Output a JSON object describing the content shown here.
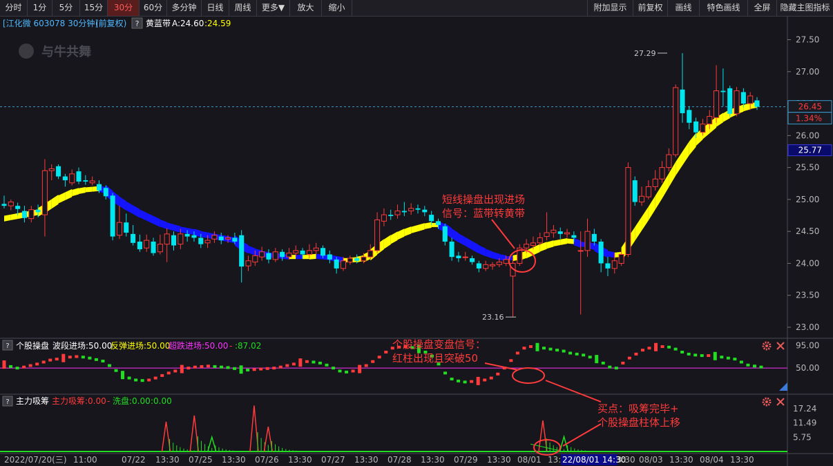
{
  "toolbar": {
    "left": [
      "分时",
      "1分",
      "5分",
      "15分",
      "30分",
      "60分",
      "多分钟",
      "日线",
      "周线",
      "更多▼",
      "放大",
      "缩小"
    ],
    "active": "30分",
    "right": [
      "附加显示",
      "前复权",
      "画线",
      "特色画线",
      "全屏",
      "隐藏主图指标"
    ]
  },
  "main_header": {
    "stock": "[江化微 603078 30分钟]",
    "adjust": "(前复权)",
    "help": "?",
    "indicator": "黄蓝带",
    "a_label": "A:24.60",
    "b_label": ":24.59"
  },
  "watermark": "与牛共舞",
  "price_axis": {
    "ticks": [
      "27.50",
      "27.00",
      "26.50",
      "26.00",
      "25.50",
      "25.00",
      "24.50",
      "24.00",
      "23.50",
      "23.00"
    ],
    "current_price": "26.45",
    "current_change": "1.34%",
    "yellow_band_value": "25.77"
  },
  "markers": {
    "high": "27.29",
    "low": "23.16"
  },
  "annotations": {
    "main_note_1": "短线操盘出现进场",
    "main_note_2": "信号：蓝带转黄带",
    "sub1_note_1": "个股操盘变盘信号：",
    "sub1_note_2": "红柱出现且突破50",
    "sub2_note_1": "买点：吸筹完毕+",
    "sub2_note_2": "个股操盘柱体上移"
  },
  "sub1": {
    "help": "?",
    "name": "个股操盘",
    "wave": "波段进场:50.00",
    "rebound": "反弹进场:50.00",
    "oversold": "超跌进场:50.00",
    "sep": "-",
    "value": ":87.02",
    "ticks": [
      "95.00",
      "50.00"
    ]
  },
  "sub2": {
    "help": "?",
    "name": "主力吸筹",
    "absorb": "主力吸筹:0.00",
    "dash": "-",
    "wash": "洗盘:0.00",
    "value": ":0.00",
    "ticks": [
      "17.24",
      "11.49",
      "5.75"
    ]
  },
  "time_axis": {
    "labels": [
      "2022/07/20(三)",
      "11:00",
      "07/22",
      "13:30",
      "07/25",
      "13:30",
      "07/26",
      "13:30",
      "07/27",
      "13:30",
      "07/28",
      "13:30",
      "07/29",
      "13:30",
      "08/01",
      "13:",
      "13:30",
      "08/03",
      "13:30",
      "08/04",
      "13:30"
    ],
    "cursor": "22/08/01 14:30"
  },
  "colors": {
    "up": "#ff3b3b",
    "down": "#00e5ee",
    "yellow_band": "#ffff00",
    "blue_band": "#1414ff",
    "accent": "#ff3b3b",
    "midline": "#ff33ff",
    "green": "#22dd22"
  },
  "chart_data": {
    "type": "candlestick",
    "ylim": [
      23.0,
      27.5
    ],
    "notes": "Approximate 30-minute candles read from the screenshot; band_color y = yellow band, b = blue band",
    "candles": [
      {
        "o": 24.93,
        "c": 24.9,
        "h": 25.06,
        "l": 24.86,
        "band": 24.7,
        "bc": "y"
      },
      {
        "o": 24.9,
        "c": 24.96,
        "h": 25.0,
        "l": 24.83,
        "band": 24.72,
        "bc": "y"
      },
      {
        "o": 24.9,
        "c": 24.85,
        "h": 24.95,
        "l": 24.75,
        "band": 24.74,
        "bc": "y"
      },
      {
        "o": 24.82,
        "c": 24.71,
        "h": 24.9,
        "l": 24.64,
        "band": 24.76,
        "bc": "y"
      },
      {
        "o": 24.7,
        "c": 24.84,
        "h": 24.9,
        "l": 24.64,
        "band": 24.78,
        "bc": "y"
      },
      {
        "o": 24.84,
        "c": 24.8,
        "h": 24.92,
        "l": 24.72,
        "band": 24.8,
        "bc": "y"
      },
      {
        "o": 24.76,
        "c": 25.45,
        "h": 25.63,
        "l": 24.42,
        "band": 24.86,
        "bc": "y"
      },
      {
        "o": 25.45,
        "c": 25.48,
        "h": 25.55,
        "l": 25.3,
        "band": 24.93,
        "bc": "y"
      },
      {
        "o": 25.52,
        "c": 25.36,
        "h": 25.55,
        "l": 25.32,
        "band": 25.0,
        "bc": "y"
      },
      {
        "o": 25.36,
        "c": 25.3,
        "h": 25.4,
        "l": 25.2,
        "band": 25.05,
        "bc": "y"
      },
      {
        "o": 25.26,
        "c": 25.4,
        "h": 25.47,
        "l": 25.22,
        "band": 25.1,
        "bc": "y"
      },
      {
        "o": 25.44,
        "c": 25.28,
        "h": 25.5,
        "l": 25.24,
        "band": 25.13,
        "bc": "y"
      },
      {
        "o": 25.3,
        "c": 25.28,
        "h": 25.38,
        "l": 25.23,
        "band": 25.15,
        "bc": "y"
      },
      {
        "o": 25.26,
        "c": 25.29,
        "h": 25.36,
        "l": 25.22,
        "band": 25.16,
        "bc": "y"
      },
      {
        "o": 25.24,
        "c": 25.14,
        "h": 25.3,
        "l": 25.1,
        "band": 25.17,
        "bc": "y"
      },
      {
        "o": 25.18,
        "c": 25.05,
        "h": 25.22,
        "l": 25.0,
        "band": 25.14,
        "bc": "b"
      },
      {
        "o": 25.06,
        "c": 24.42,
        "h": 25.1,
        "l": 24.36,
        "band": 25.05,
        "bc": "b"
      },
      {
        "o": 24.44,
        "c": 24.64,
        "h": 24.9,
        "l": 24.38,
        "band": 24.97,
        "bc": "b"
      },
      {
        "o": 24.64,
        "c": 24.48,
        "h": 24.78,
        "l": 24.42,
        "band": 24.9,
        "bc": "b"
      },
      {
        "o": 24.46,
        "c": 24.32,
        "h": 24.6,
        "l": 24.28,
        "band": 24.84,
        "bc": "b"
      },
      {
        "o": 24.34,
        "c": 24.22,
        "h": 24.45,
        "l": 24.18,
        "band": 24.78,
        "bc": "b"
      },
      {
        "o": 24.24,
        "c": 24.36,
        "h": 24.45,
        "l": 24.18,
        "band": 24.73,
        "bc": "b"
      },
      {
        "o": 24.34,
        "c": 24.16,
        "h": 24.4,
        "l": 24.12,
        "band": 24.68,
        "bc": "b"
      },
      {
        "o": 24.18,
        "c": 24.3,
        "h": 24.45,
        "l": 24.14,
        "band": 24.63,
        "bc": "b"
      },
      {
        "o": 24.3,
        "c": 24.46,
        "h": 24.55,
        "l": 24.02,
        "band": 24.59,
        "bc": "b"
      },
      {
        "o": 24.44,
        "c": 24.28,
        "h": 24.5,
        "l": 24.2,
        "band": 24.56,
        "bc": "b"
      },
      {
        "o": 24.3,
        "c": 24.46,
        "h": 24.54,
        "l": 24.22,
        "band": 24.53,
        "bc": "b"
      },
      {
        "o": 24.46,
        "c": 24.42,
        "h": 24.52,
        "l": 24.34,
        "band": 24.51,
        "bc": "b"
      },
      {
        "o": 24.44,
        "c": 24.4,
        "h": 24.5,
        "l": 24.34,
        "band": 24.49,
        "bc": "b"
      },
      {
        "o": 24.4,
        "c": 24.3,
        "h": 24.46,
        "l": 24.24,
        "band": 24.46,
        "bc": "b"
      },
      {
        "o": 24.32,
        "c": 24.36,
        "h": 24.44,
        "l": 24.24,
        "band": 24.44,
        "bc": "b"
      },
      {
        "o": 24.38,
        "c": 24.44,
        "h": 24.5,
        "l": 24.32,
        "band": 24.42,
        "bc": "b"
      },
      {
        "o": 24.42,
        "c": 24.36,
        "h": 24.48,
        "l": 24.3,
        "band": 24.4,
        "bc": "b"
      },
      {
        "o": 24.38,
        "c": 24.4,
        "h": 24.44,
        "l": 24.32,
        "band": 24.38,
        "bc": "b"
      },
      {
        "o": 24.4,
        "c": 24.34,
        "h": 24.48,
        "l": 24.3,
        "band": 24.36,
        "bc": "b"
      },
      {
        "o": 24.44,
        "c": 23.95,
        "h": 24.52,
        "l": 23.7,
        "band": 24.28,
        "bc": "b"
      },
      {
        "o": 23.96,
        "c": 24.04,
        "h": 24.12,
        "l": 23.88,
        "band": 24.22,
        "bc": "b"
      },
      {
        "o": 24.02,
        "c": 24.12,
        "h": 24.2,
        "l": 23.96,
        "band": 24.18,
        "bc": "b"
      },
      {
        "o": 24.1,
        "c": 24.18,
        "h": 24.26,
        "l": 24.04,
        "band": 24.15,
        "bc": "b"
      },
      {
        "o": 24.16,
        "c": 24.06,
        "h": 24.22,
        "l": 24.0,
        "band": 24.13,
        "bc": "b"
      },
      {
        "o": 24.06,
        "c": 24.18,
        "h": 24.24,
        "l": 24.02,
        "band": 24.12,
        "bc": "b"
      },
      {
        "o": 24.18,
        "c": 24.1,
        "h": 24.22,
        "l": 24.04,
        "band": 24.11,
        "bc": "b"
      },
      {
        "o": 24.1,
        "c": 24.16,
        "h": 24.24,
        "l": 24.06,
        "band": 24.1,
        "bc": "b"
      },
      {
        "o": 24.16,
        "c": 24.2,
        "h": 24.28,
        "l": 24.1,
        "band": 24.1,
        "bc": "y"
      },
      {
        "o": 24.2,
        "c": 24.14,
        "h": 24.24,
        "l": 24.08,
        "band": 24.1,
        "bc": "b"
      },
      {
        "o": 24.14,
        "c": 24.2,
        "h": 24.3,
        "l": 24.08,
        "band": 24.1,
        "bc": "y"
      },
      {
        "o": 24.2,
        "c": 24.24,
        "h": 24.32,
        "l": 24.14,
        "band": 24.11,
        "bc": "y"
      },
      {
        "o": 24.24,
        "c": 24.12,
        "h": 24.28,
        "l": 24.08,
        "band": 24.1,
        "bc": "b"
      },
      {
        "o": 24.14,
        "c": 24.06,
        "h": 24.2,
        "l": 24.0,
        "band": 24.09,
        "bc": "b"
      },
      {
        "o": 24.06,
        "c": 23.92,
        "h": 24.1,
        "l": 23.84,
        "band": 24.07,
        "bc": "b"
      },
      {
        "o": 23.92,
        "c": 24.04,
        "h": 24.1,
        "l": 23.88,
        "band": 24.05,
        "bc": "b"
      },
      {
        "o": 24.02,
        "c": 24.08,
        "h": 24.12,
        "l": 23.98,
        "band": 24.05,
        "bc": "y"
      },
      {
        "o": 24.08,
        "c": 24.04,
        "h": 24.14,
        "l": 24.0,
        "band": 24.06,
        "bc": "y"
      },
      {
        "o": 24.04,
        "c": 24.1,
        "h": 24.16,
        "l": 24.0,
        "band": 24.08,
        "bc": "y"
      },
      {
        "o": 24.1,
        "c": 24.2,
        "h": 24.3,
        "l": 24.06,
        "band": 24.13,
        "bc": "y"
      },
      {
        "o": 24.2,
        "c": 24.68,
        "h": 24.8,
        "l": 24.16,
        "band": 24.22,
        "bc": "y"
      },
      {
        "o": 24.66,
        "c": 24.76,
        "h": 24.86,
        "l": 24.58,
        "band": 24.3,
        "bc": "y"
      },
      {
        "o": 24.76,
        "c": 24.74,
        "h": 24.84,
        "l": 24.68,
        "band": 24.37,
        "bc": "y"
      },
      {
        "o": 24.76,
        "c": 24.82,
        "h": 24.92,
        "l": 24.7,
        "band": 24.43,
        "bc": "y"
      },
      {
        "o": 24.82,
        "c": 24.8,
        "h": 24.96,
        "l": 24.74,
        "band": 24.48,
        "bc": "y"
      },
      {
        "o": 24.82,
        "c": 24.86,
        "h": 24.94,
        "l": 24.76,
        "band": 24.52,
        "bc": "y"
      },
      {
        "o": 24.86,
        "c": 24.84,
        "h": 24.92,
        "l": 24.78,
        "band": 24.55,
        "bc": "y"
      },
      {
        "o": 24.84,
        "c": 24.8,
        "h": 24.9,
        "l": 24.74,
        "band": 24.58,
        "bc": "y"
      },
      {
        "o": 24.76,
        "c": 24.66,
        "h": 24.82,
        "l": 24.6,
        "band": 24.6,
        "bc": "y"
      },
      {
        "o": 24.66,
        "c": 24.6,
        "h": 24.7,
        "l": 24.54,
        "band": 24.6,
        "bc": "y"
      },
      {
        "o": 24.58,
        "c": 24.34,
        "h": 24.62,
        "l": 24.28,
        "band": 24.55,
        "bc": "b"
      },
      {
        "o": 24.34,
        "c": 24.1,
        "h": 24.4,
        "l": 24.04,
        "band": 24.47,
        "bc": "b"
      },
      {
        "o": 24.12,
        "c": 24.08,
        "h": 24.18,
        "l": 24.02,
        "band": 24.4,
        "bc": "b"
      },
      {
        "o": 24.1,
        "c": 24.1,
        "h": 24.18,
        "l": 24.04,
        "band": 24.34,
        "bc": "b"
      },
      {
        "o": 24.08,
        "c": 24.02,
        "h": 24.12,
        "l": 23.98,
        "band": 24.28,
        "bc": "b"
      },
      {
        "o": 24.0,
        "c": 23.92,
        "h": 24.04,
        "l": 23.86,
        "band": 24.22,
        "bc": "b"
      },
      {
        "o": 23.92,
        "c": 23.98,
        "h": 24.04,
        "l": 23.88,
        "band": 24.17,
        "bc": "b"
      },
      {
        "o": 23.96,
        "c": 23.98,
        "h": 24.02,
        "l": 23.9,
        "band": 24.13,
        "bc": "b"
      },
      {
        "o": 23.98,
        "c": 24.02,
        "h": 24.08,
        "l": 23.94,
        "band": 24.1,
        "bc": "b"
      },
      {
        "o": 24.0,
        "c": 24.06,
        "h": 24.12,
        "l": 23.96,
        "band": 24.08,
        "bc": "b"
      },
      {
        "o": 23.8,
        "c": 24.0,
        "h": 24.1,
        "l": 23.16,
        "band": 24.08,
        "bc": "b"
      },
      {
        "o": 24.0,
        "c": 24.24,
        "h": 24.3,
        "l": 23.96,
        "band": 24.1,
        "bc": "y"
      },
      {
        "o": 24.24,
        "c": 24.3,
        "h": 24.38,
        "l": 24.16,
        "band": 24.14,
        "bc": "y"
      },
      {
        "o": 24.28,
        "c": 24.32,
        "h": 24.42,
        "l": 24.22,
        "band": 24.19,
        "bc": "y"
      },
      {
        "o": 24.32,
        "c": 24.4,
        "h": 24.48,
        "l": 24.28,
        "band": 24.24,
        "bc": "y"
      },
      {
        "o": 24.42,
        "c": 24.48,
        "h": 24.8,
        "l": 24.36,
        "band": 24.28,
        "bc": "y"
      },
      {
        "o": 24.48,
        "c": 24.52,
        "h": 24.6,
        "l": 24.4,
        "band": 24.31,
        "bc": "y"
      },
      {
        "o": 24.5,
        "c": 24.46,
        "h": 24.56,
        "l": 24.38,
        "band": 24.33,
        "bc": "y"
      },
      {
        "o": 24.46,
        "c": 24.48,
        "h": 24.54,
        "l": 24.4,
        "band": 24.35,
        "bc": "y"
      },
      {
        "o": 24.44,
        "c": 24.4,
        "h": 24.5,
        "l": 24.34,
        "band": 24.34,
        "bc": "y"
      },
      {
        "o": 24.2,
        "c": 24.2,
        "h": 24.5,
        "l": 23.2,
        "band": 24.3,
        "bc": "b"
      },
      {
        "o": 24.2,
        "c": 24.5,
        "h": 24.7,
        "l": 24.1,
        "band": 24.29,
        "bc": "b"
      },
      {
        "o": 24.46,
        "c": 24.34,
        "h": 24.54,
        "l": 24.28,
        "band": 24.26,
        "bc": "b"
      },
      {
        "o": 24.34,
        "c": 24.0,
        "h": 24.38,
        "l": 23.86,
        "band": 24.2,
        "bc": "b"
      },
      {
        "o": 24.0,
        "c": 23.92,
        "h": 24.1,
        "l": 23.8,
        "band": 24.15,
        "bc": "b"
      },
      {
        "o": 23.92,
        "c": 24.04,
        "h": 24.16,
        "l": 23.84,
        "band": 24.13,
        "bc": "b"
      },
      {
        "o": 24.0,
        "c": 24.14,
        "h": 24.2,
        "l": 23.96,
        "band": 24.14,
        "bc": "y"
      },
      {
        "o": 24.14,
        "c": 25.5,
        "h": 25.58,
        "l": 24.1,
        "band": 24.3,
        "bc": "y"
      },
      {
        "o": 25.3,
        "c": 24.96,
        "h": 25.36,
        "l": 24.9,
        "band": 24.46,
        "bc": "y"
      },
      {
        "o": 24.96,
        "c": 25.05,
        "h": 25.2,
        "l": 24.9,
        "band": 24.62,
        "bc": "y"
      },
      {
        "o": 25.04,
        "c": 25.2,
        "h": 25.3,
        "l": 25.0,
        "band": 24.78,
        "bc": "y"
      },
      {
        "o": 25.2,
        "c": 25.32,
        "h": 25.46,
        "l": 25.14,
        "band": 24.95,
        "bc": "y"
      },
      {
        "o": 25.32,
        "c": 25.5,
        "h": 25.6,
        "l": 25.26,
        "band": 25.12,
        "bc": "y"
      },
      {
        "o": 25.5,
        "c": 25.7,
        "h": 25.8,
        "l": 25.44,
        "band": 25.3,
        "bc": "y"
      },
      {
        "o": 25.7,
        "c": 26.75,
        "h": 26.8,
        "l": 25.66,
        "band": 25.48,
        "bc": "y"
      },
      {
        "o": 26.72,
        "c": 26.35,
        "h": 27.29,
        "l": 26.2,
        "band": 25.64,
        "bc": "y"
      },
      {
        "o": 26.4,
        "c": 26.2,
        "h": 26.46,
        "l": 26.1,
        "band": 25.8,
        "bc": "y"
      },
      {
        "o": 26.22,
        "c": 26.05,
        "h": 26.28,
        "l": 25.96,
        "band": 25.93,
        "bc": "y"
      },
      {
        "o": 26.05,
        "c": 26.18,
        "h": 26.26,
        "l": 26.0,
        "band": 26.03,
        "bc": "y"
      },
      {
        "o": 26.18,
        "c": 26.3,
        "h": 26.4,
        "l": 26.1,
        "band": 26.12,
        "bc": "y"
      },
      {
        "o": 26.28,
        "c": 26.7,
        "h": 27.1,
        "l": 26.2,
        "band": 26.21,
        "bc": "y"
      },
      {
        "o": 26.7,
        "c": 26.68,
        "h": 27.05,
        "l": 26.46,
        "band": 26.28,
        "bc": "y"
      },
      {
        "o": 26.74,
        "c": 26.34,
        "h": 26.78,
        "l": 26.3,
        "band": 26.34,
        "bc": "y"
      },
      {
        "o": 26.34,
        "c": 26.7,
        "h": 26.76,
        "l": 26.3,
        "band": 26.39,
        "bc": "y"
      },
      {
        "o": 26.68,
        "c": 26.5,
        "h": 26.74,
        "l": 26.44,
        "band": 26.43,
        "bc": "y"
      },
      {
        "o": 26.5,
        "c": 26.62,
        "h": 26.68,
        "l": 26.4,
        "band": 26.46,
        "bc": "y"
      },
      {
        "o": 26.55,
        "c": 26.45,
        "h": 26.6,
        "l": 26.4,
        "band": 26.48,
        "bc": "y"
      }
    ],
    "sub1_values": [
      57,
      53,
      50,
      52,
      55,
      58,
      62,
      66,
      68,
      70,
      72,
      73,
      72,
      70,
      67,
      64,
      55,
      45,
      36,
      30,
      26,
      25,
      26,
      30,
      35,
      40,
      44,
      48,
      50,
      52,
      53,
      54,
      53,
      52,
      51,
      49,
      47,
      46,
      47,
      48,
      49,
      50,
      52,
      55,
      58,
      61,
      63,
      62,
      60,
      56,
      50,
      44,
      42,
      44,
      48,
      55,
      63,
      72,
      82,
      90,
      92,
      93,
      91,
      88,
      82,
      74,
      58,
      40,
      28,
      24,
      22,
      23,
      24,
      26,
      30,
      38,
      50,
      65,
      80,
      90,
      93,
      92,
      90,
      88,
      86,
      84,
      80,
      78,
      76,
      72,
      68,
      60,
      52,
      50,
      60,
      70,
      78,
      86,
      90,
      92,
      93,
      92,
      88,
      82,
      78,
      76,
      75,
      75,
      74,
      72,
      70,
      68,
      62,
      56,
      54,
      52
    ],
    "sub1_colors": "red for rising, green for falling",
    "sub2_spikes": [
      {
        "at": 46,
        "value": 12.0
      },
      {
        "at": 54,
        "value": 14.5
      },
      {
        "at": 59,
        "value": 5.8
      },
      {
        "at": 71,
        "value": 18.5
      },
      {
        "at": 75,
        "value": 10.0
      },
      {
        "at": 153,
        "value": 12.5
      },
      {
        "at": 159,
        "value": 6.0
      }
    ],
    "sub2_ylim": [
      0,
      20
    ]
  }
}
